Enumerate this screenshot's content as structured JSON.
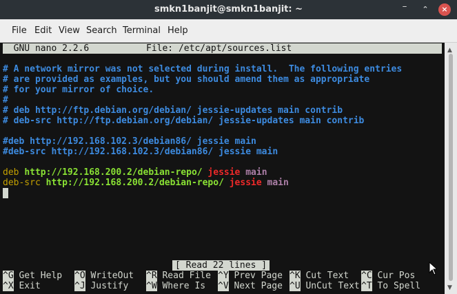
{
  "window": {
    "title": "smkn1banjit@smkn1banjit: ~"
  },
  "menu": [
    "File",
    "Edit",
    "View",
    "Search",
    "Terminal",
    "Help"
  ],
  "nano": {
    "header_app": "  GNU nano 2.2.6",
    "header_file": "File: /etc/apt/sources.list",
    "comments": [
      "# A network mirror was not selected during install.  The following entries",
      "# are provided as examples, but you should amend them as appropriate",
      "# for your mirror of choice.",
      "#",
      "# deb http://ftp.debian.org/debian/ jessie-updates main contrib",
      "# deb-src http://ftp.debian.org/debian/ jessie-updates main contrib",
      "#deb http://192.168.102.3/debian86/ jessie main",
      "#deb-src http://192.168.102.3/debian86/ jessie main"
    ],
    "entries": [
      {
        "type": "deb",
        "url": "http://192.168.200.2/debian-repo/",
        "dist": "jessie",
        "comp": "main"
      },
      {
        "type": "deb-src",
        "url": "http://192.168.200.2/debian-repo/",
        "dist": "jessie",
        "comp": "main"
      }
    ],
    "status": "[ Read 22 lines ]",
    "shortcuts_row1": [
      {
        "key": "^G",
        "label": "Get Help"
      },
      {
        "key": "^O",
        "label": "WriteOut"
      },
      {
        "key": "^R",
        "label": "Read File"
      },
      {
        "key": "^Y",
        "label": "Prev Page"
      },
      {
        "key": "^K",
        "label": "Cut Text"
      },
      {
        "key": "^C",
        "label": "Cur Pos"
      }
    ],
    "shortcuts_row2": [
      {
        "key": "^X",
        "label": "Exit"
      },
      {
        "key": "^J",
        "label": "Justify"
      },
      {
        "key": "^W",
        "label": "Where Is"
      },
      {
        "key": "^V",
        "label": "Next Page"
      },
      {
        "key": "^U",
        "label": "UnCut Text"
      },
      {
        "key": "^T",
        "label": "To Spell"
      }
    ]
  },
  "icons": {
    "minimize": "minimize-icon",
    "maximize": "maximize-icon",
    "close": "close-icon"
  }
}
